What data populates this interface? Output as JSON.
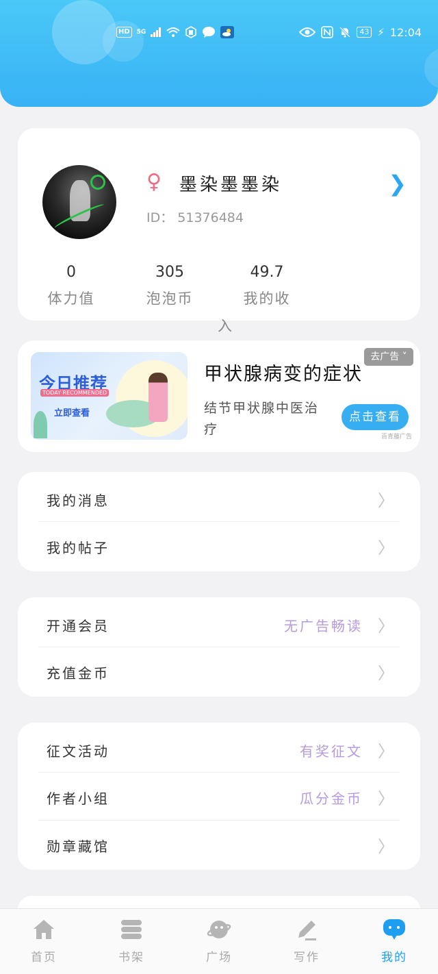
{
  "status_bar": {
    "hd": "HD",
    "network": "5G",
    "battery": "43",
    "time": "12:04"
  },
  "profile": {
    "gender_symbol": "♀",
    "nickname": "墨染墨墨染",
    "id_text": "ID：  51376484",
    "stats": [
      {
        "value": "0",
        "label": "体力值"
      },
      {
        "value": "305",
        "label": "泡泡币"
      },
      {
        "value": "49.7",
        "label": "我的收"
      }
    ],
    "stat_overflow": "入"
  },
  "ad": {
    "image_title": "今日推荐",
    "image_subtitle": "TODAY RECOMMENDED",
    "image_cta": "立即查看",
    "title": "甲状腺病变的症状",
    "description": "结节甲状腺中医治疗",
    "close_label": "去广告",
    "button_label": "点击查看",
    "source": "百青藤广告"
  },
  "menu_groups": [
    [
      {
        "label": "我的消息",
        "hint": ""
      },
      {
        "label": "我的帖子",
        "hint": ""
      }
    ],
    [
      {
        "label": "开通会员",
        "hint": "无广告畅读"
      },
      {
        "label": "充值金币",
        "hint": ""
      }
    ],
    [
      {
        "label": "征文活动",
        "hint": "有奖征文"
      },
      {
        "label": "作者小组",
        "hint": "瓜分金币"
      },
      {
        "label": "勋章藏馆",
        "hint": ""
      }
    ]
  ],
  "bottom_nav": [
    {
      "label": "首页",
      "icon": "home-icon",
      "active": false
    },
    {
      "label": "书架",
      "icon": "bookshelf-icon",
      "active": false
    },
    {
      "label": "广场",
      "icon": "planet-icon",
      "active": false
    },
    {
      "label": "写作",
      "icon": "pen-icon",
      "active": false
    },
    {
      "label": "我的",
      "icon": "chat-bubble-icon",
      "active": true
    }
  ],
  "colors": {
    "header": "#38b2f5",
    "accent": "#1e9ef0",
    "hint": "#b69ae0",
    "gender": "#f06a86"
  }
}
